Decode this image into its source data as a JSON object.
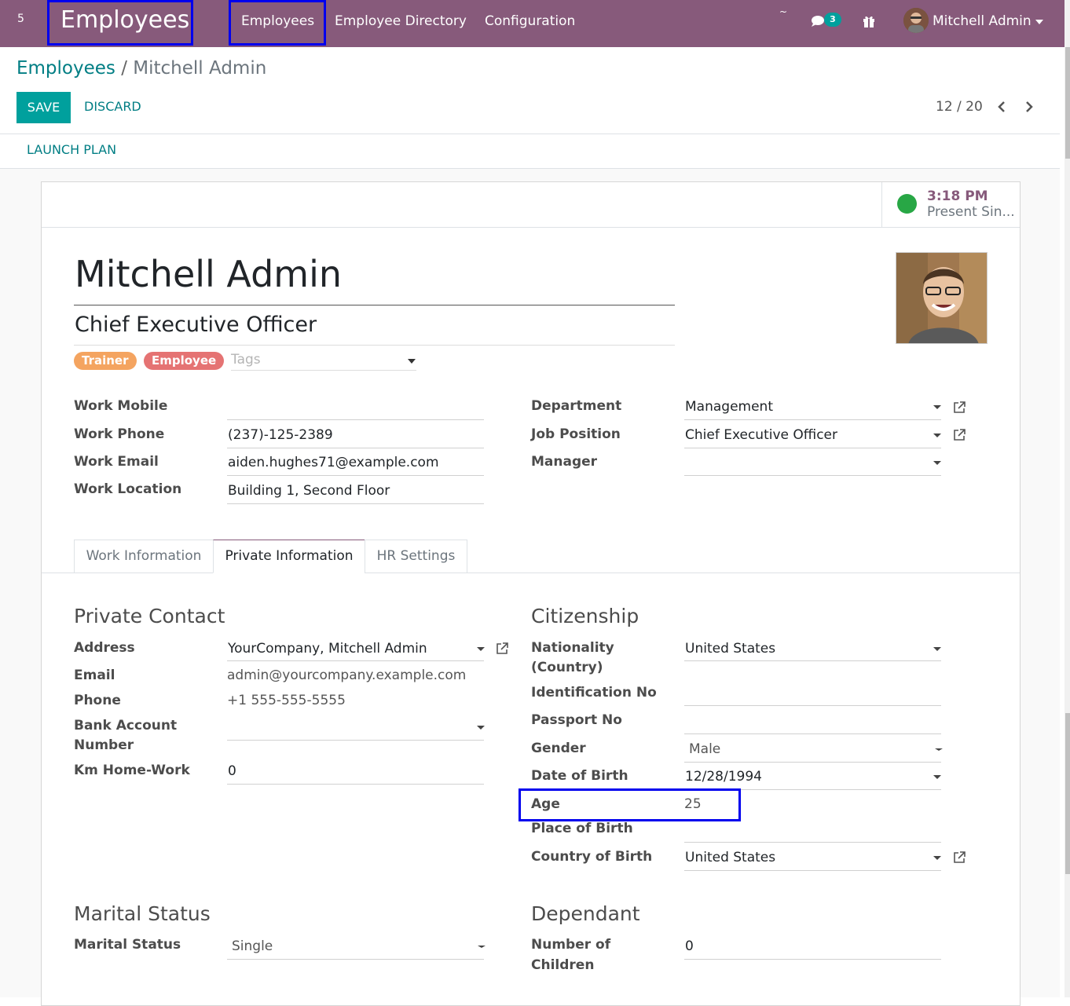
{
  "navbar": {
    "count": "5",
    "app_title": "Employees",
    "menu": [
      "Employees",
      "Employee Directory",
      "Configuration"
    ],
    "tilde": "~",
    "chat_badge": "3",
    "user_name": "Mitchell Admin",
    "bg_color": "#875a7b"
  },
  "breadcrumb": {
    "parent": "Employees",
    "separator": "/",
    "current": "Mitchell Admin"
  },
  "buttons": {
    "save": "SAVE",
    "discard": "DISCARD",
    "launch_plan": "LAUNCH PLAN"
  },
  "pager": {
    "text": "12 / 20"
  },
  "attendance": {
    "time": "3:18 PM",
    "status": "Present Sin..."
  },
  "employee": {
    "name": "Mitchell Admin",
    "job_title": "Chief Executive Officer",
    "tags": [
      "Trainer",
      "Employee"
    ],
    "tags_placeholder": "Tags"
  },
  "work_fields": {
    "work_mobile_label": "Work Mobile",
    "work_mobile": "",
    "work_phone_label": "Work Phone",
    "work_phone": "(237)-125-2389",
    "work_email_label": "Work Email",
    "work_email": "aiden.hughes71@example.com",
    "work_location_label": "Work Location",
    "work_location": "Building 1, Second Floor",
    "department_label": "Department",
    "department": "Management",
    "job_position_label": "Job Position",
    "job_position": "Chief Executive Officer",
    "manager_label": "Manager",
    "manager": ""
  },
  "tabs": [
    "Work Information",
    "Private Information",
    "HR Settings"
  ],
  "active_tab": "Private Information",
  "private_contact": {
    "heading": "Private Contact",
    "address_label": "Address",
    "address": "YourCompany, Mitchell Admin",
    "email_label": "Email",
    "email": "admin@yourcompany.example.com",
    "phone_label": "Phone",
    "phone": "+1 555-555-5555",
    "bank_label_1": "Bank Account",
    "bank_label_2": "Number",
    "bank": "",
    "km_label": "Km Home-Work",
    "km": "0"
  },
  "citizenship": {
    "heading": "Citizenship",
    "nationality_label_1": "Nationality",
    "nationality_label_2": "(Country)",
    "nationality": "United States",
    "identification_label": "Identification No",
    "identification": "",
    "passport_label": "Passport No",
    "passport": "",
    "gender_label": "Gender",
    "gender": "Male",
    "dob_label": "Date of Birth",
    "dob": "12/28/1994",
    "age_label": "Age",
    "age": "25",
    "pob_label": "Place of Birth",
    "pob": "",
    "cob_label": "Country of Birth",
    "cob": "United States"
  },
  "marital": {
    "heading": "Marital Status",
    "label": "Marital Status",
    "value": "Single"
  },
  "dependant": {
    "heading": "Dependant",
    "label_1": "Number of",
    "label_2": "Children",
    "value": "0"
  }
}
